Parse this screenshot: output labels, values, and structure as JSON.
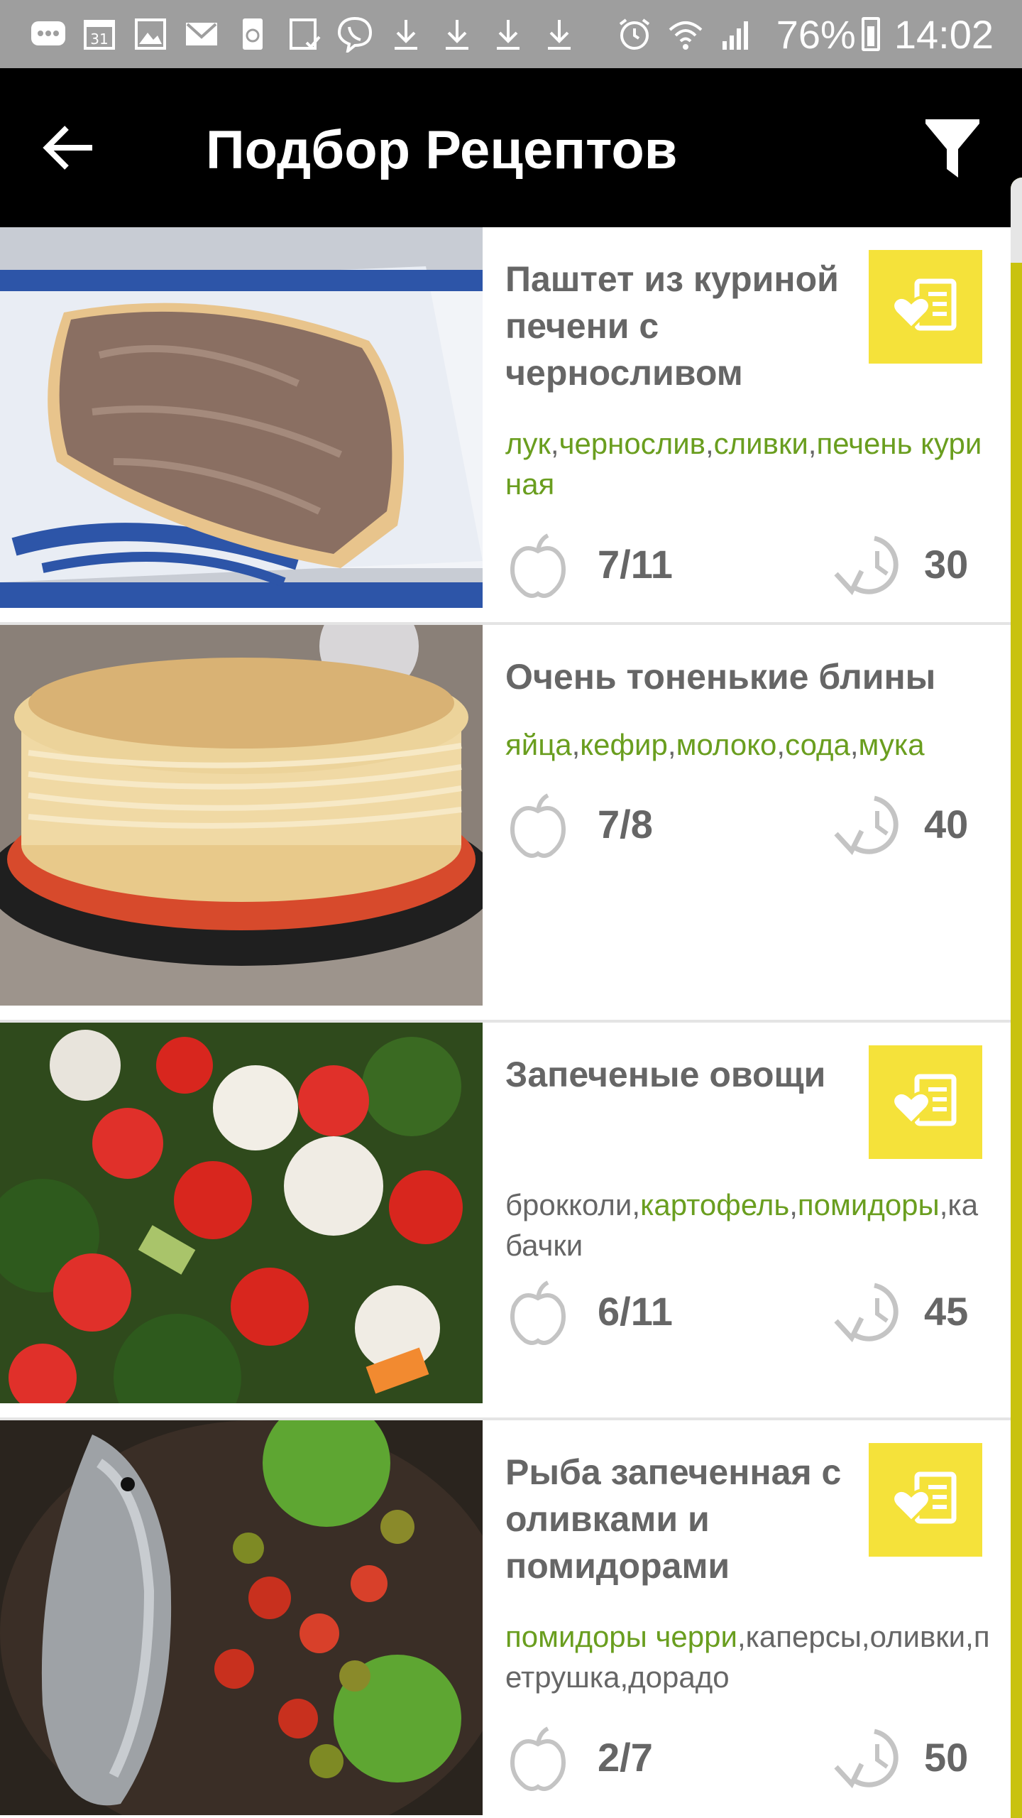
{
  "status_bar": {
    "calendar_day": "31",
    "battery_percent": "76%",
    "time": "14:02",
    "icons": [
      "chat-icon",
      "calendar-icon",
      "gallery-icon",
      "gmail-icon",
      "recycle-icon",
      "clipboard-icon",
      "viber-icon",
      "download-icon",
      "download-icon",
      "download-icon",
      "download-icon",
      "alarm-icon",
      "wifi-icon",
      "signal-icon",
      "battery-icon"
    ]
  },
  "app_bar": {
    "title": "Подбор Рецептов",
    "back_icon": "arrow-back-icon",
    "filter_icon": "filter-icon"
  },
  "colors": {
    "app_bar": "#000000",
    "status_bar": "#9e9e9e",
    "accent_yellow": "#f5e23a",
    "ingredient_have": "#6a9e1f",
    "text_gray": "#666666"
  },
  "recipes": [
    {
      "title": "Паштет из куриной печени с черносливом",
      "favorite_button": true,
      "ingredients": [
        {
          "name": "лук",
          "have": true
        },
        {
          "name": "чернослив",
          "have": true
        },
        {
          "name": "сливки",
          "have": true
        },
        {
          "name": "печень куриная",
          "have": true
        }
      ],
      "ingredient_count": "7/11",
      "time": "30"
    },
    {
      "title": "Очень тоненькие блины",
      "favorite_button": false,
      "ingredients": [
        {
          "name": "яйца",
          "have": true
        },
        {
          "name": "кефир",
          "have": true
        },
        {
          "name": "молоко",
          "have": true
        },
        {
          "name": "сода",
          "have": true
        },
        {
          "name": "мука",
          "have": true
        }
      ],
      "ingredient_count": "7/8",
      "time": "40"
    },
    {
      "title": "Запеченые овощи",
      "favorite_button": true,
      "ingredients": [
        {
          "name": "брокколи",
          "have": false
        },
        {
          "name": "картофель",
          "have": true
        },
        {
          "name": "помидоры",
          "have": true
        },
        {
          "name": "кабачки",
          "have": false
        }
      ],
      "ingredient_count": "6/11",
      "time": "45"
    },
    {
      "title": "Рыба запеченная с оливками и помидорами",
      "favorite_button": true,
      "ingredients": [
        {
          "name": "помидоры черри",
          "have": true
        },
        {
          "name": "каперсы",
          "have": false
        },
        {
          "name": "оливки",
          "have": false
        },
        {
          "name": "петрушка",
          "have": false
        },
        {
          "name": "дорадо",
          "have": false
        }
      ],
      "ingredient_count": "2/7",
      "time": "50"
    }
  ]
}
